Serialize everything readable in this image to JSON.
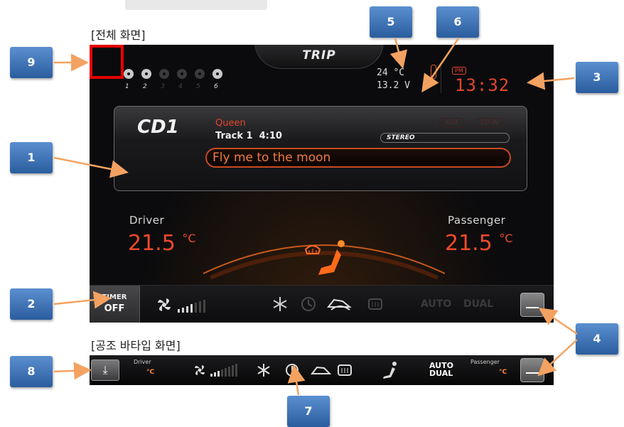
{
  "headings": {
    "full_screen": "[전체 화면]",
    "hvac_bar": "[공조 바타입 화면]"
  },
  "header": {
    "trip_label": "TRIP"
  },
  "presets": {
    "discs": [
      {
        "number": "1",
        "active": true
      },
      {
        "number": "2",
        "active": true
      },
      {
        "number": "3",
        "active": false
      },
      {
        "number": "4",
        "active": false
      },
      {
        "number": "5",
        "active": false
      },
      {
        "number": "6",
        "active": true
      }
    ]
  },
  "status": {
    "outside_temp": "24",
    "temp_unit": "°C",
    "voltage": "13.2",
    "voltage_unit": "V",
    "ampm": "PM",
    "clock": "13:32"
  },
  "media": {
    "source": "CD1",
    "artist": "Queen",
    "track": "Track 1",
    "time": "4:10",
    "aux_label": "AUX",
    "cdin_label": "CD IN",
    "stereo_label": "STEREO",
    "song_title": "Fly me to the moon"
  },
  "climate": {
    "driver_label": "Driver",
    "driver_temp": "21.5",
    "passenger_label": "Passenger",
    "passenger_temp": "21.5",
    "temp_unit": "°C",
    "fan_level": 4,
    "fan_max": 7
  },
  "bottom_bar": {
    "timer_label": "TIMER",
    "timer_value": "OFF",
    "auto_label": "AUTO",
    "dual_label": "DUAL"
  },
  "strip": {
    "driver_label": "Driver",
    "passenger_label": "Passenger",
    "temp_unit": "°C",
    "auto_label": "AUTO",
    "dual_label": "DUAL",
    "fan_level": 3,
    "fan_max": 8
  },
  "badges": [
    "1",
    "2",
    "3",
    "4",
    "5",
    "6",
    "7",
    "8",
    "9"
  ],
  "colors": {
    "accent_red": "#e2452f",
    "accent_orange": "#f07a40",
    "badge_blue": "#3a6fb4",
    "arrow_orange": "#f4a261",
    "highlight_red": "#e60000"
  }
}
